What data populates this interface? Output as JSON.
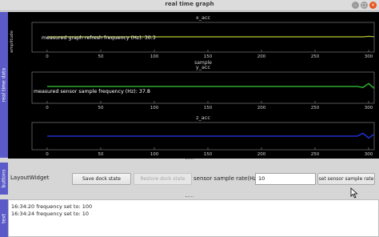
{
  "window": {
    "title": "real time graph"
  },
  "dock_tabs": {
    "plots": "real time data",
    "buttons": "buttons",
    "text": "text"
  },
  "plots": [
    {
      "title": "x_acc",
      "ylabel": "amplitude",
      "xlabel": "sample",
      "annotation": "measured graph refresh frequency (Hz): 30.3",
      "line_color": "#b8c832"
    },
    {
      "title": "y_acc",
      "annotation": "measured sensor sample frequency (Hz): 37.8",
      "line_color": "#2ea82e"
    },
    {
      "title": "z_acc",
      "line_color": "#1f2fd0"
    }
  ],
  "x_ticks": [
    "0",
    "50",
    "100",
    "150",
    "200",
    "250",
    "300"
  ],
  "buttons": {
    "layout_label": "LayoutWidget",
    "save_dock": "Save dock state",
    "restore_dock": "Restore dock state",
    "sample_rate_label": "sensor sample rate(Hz):",
    "sample_rate_value": "10",
    "set_sample_rate": "set sensor sample rate"
  },
  "log": [
    "16:34:20 frequency set to: 100",
    "16:34:24 frequency set to: 10"
  ],
  "chart_data": [
    {
      "type": "line",
      "title": "x_acc",
      "xlabel": "sample",
      "ylabel": "amplitude",
      "xlim": [
        0,
        300
      ],
      "series": [
        {
          "values": [
            0,
            0,
            0,
            0,
            0,
            0,
            0,
            0,
            0,
            0,
            0.05,
            0.02
          ]
        }
      ]
    },
    {
      "type": "line",
      "title": "y_acc",
      "xlim": [
        0,
        300
      ],
      "series": [
        {
          "values": [
            0,
            0,
            0,
            0,
            0,
            0,
            0,
            0,
            0,
            0,
            -0.1,
            0.3,
            -0.2
          ]
        }
      ]
    },
    {
      "type": "line",
      "title": "z_acc",
      "xlim": [
        0,
        300
      ],
      "series": [
        {
          "values": [
            0,
            0,
            0,
            0,
            0,
            0,
            0,
            0,
            0,
            0,
            0.3,
            -0.2,
            0.2
          ]
        }
      ]
    }
  ]
}
